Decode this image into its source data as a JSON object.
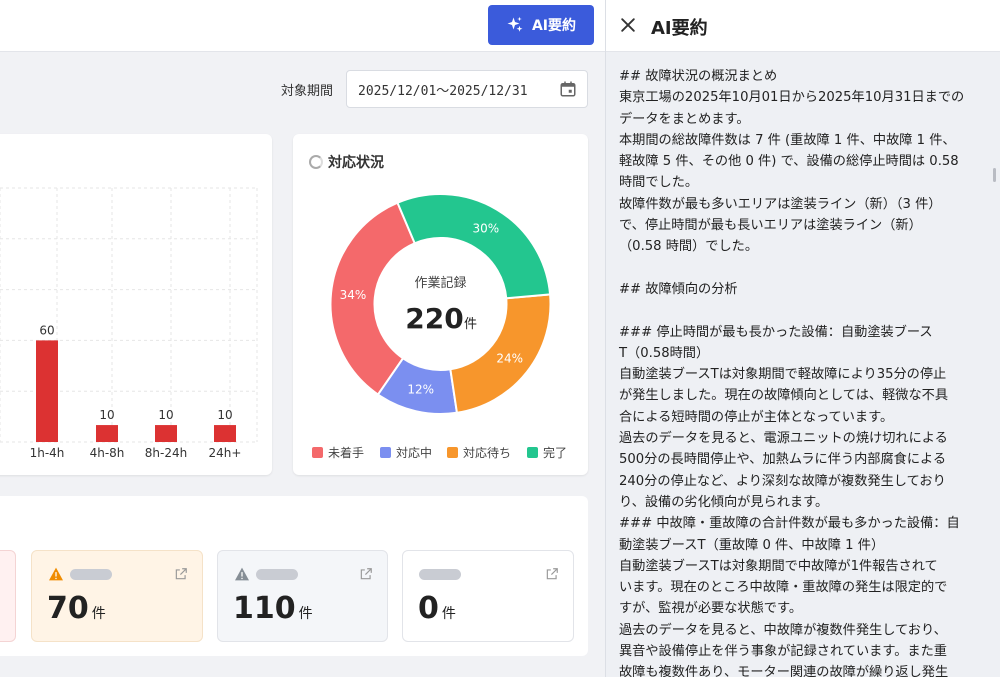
{
  "toolbar": {
    "ai_button_label": "AI要約"
  },
  "filter": {
    "period_label": "対象期間",
    "period_value": "2025/12/01〜2025/12/31"
  },
  "chart_data": [
    {
      "type": "bar",
      "categories": [
        "h",
        "1h-4h",
        "4h-8h",
        "8h-24h",
        "24h+"
      ],
      "values": [
        null,
        60,
        10,
        10,
        10
      ],
      "value_labels": [
        "",
        "60",
        "10",
        "10",
        "10"
      ],
      "ylim": [
        0,
        150
      ],
      "grid": true,
      "colors": {
        "bar": "#dc3232",
        "grid": "#e6e6e6"
      }
    },
    {
      "type": "pie",
      "title": "対応状況",
      "center_label": "作業記録",
      "center_value": "220",
      "center_unit": "件",
      "series": [
        {
          "name": "未着手",
          "value": 34,
          "label": "34%",
          "color": "#f4696b"
        },
        {
          "name": "対応中",
          "value": 12,
          "label": "12%",
          "color": "#7b8ff0"
        },
        {
          "name": "対応待ち",
          "value": 24,
          "label": "24%",
          "color": "#f7962c"
        },
        {
          "name": "完了",
          "value": 30,
          "label": "30%",
          "color": "#23c68f"
        }
      ]
    }
  ],
  "stats": [
    {
      "value": "70",
      "unit": "件",
      "icon": "warning-icon",
      "bg": "#fff4e6",
      "icon_color": "#f08c00"
    },
    {
      "value": "110",
      "unit": "件",
      "icon": "warning-icon",
      "bg": "#f4f6f9",
      "icon_color": "#868e96"
    },
    {
      "value": "0",
      "unit": "件",
      "icon": "none",
      "bg": "#ffffff"
    }
  ],
  "ai_panel": {
    "title": "AI要約",
    "lines": [
      "## 故障状況の概況まとめ",
      "東京工場の2025年10月01日から2025年10月31日までの",
      "データをまとめます。",
      "本期間の総故障件数は 7 件 (重故障 1 件、中故障 1 件、",
      "軽故障 5 件、その他 0 件) で、設備の総停止時間は 0.58",
      "時間でした。",
      "故障件数が最も多いエリアは塗装ライン（新）（3 件）",
      "で、停止時間が最も長いエリアは塗装ライン（新）",
      "（0.58 時間）でした。",
      "",
      "## 故障傾向の分析",
      "",
      "### 停止時間が最も長かった設備：自動塗装ブース",
      "T（0.58時間）",
      "自動塗装ブースTは対象期間で軽故障により35分の停止",
      "が発生しました。現在の故障傾向としては、軽微な不具",
      "合による短時間の停止が主体となっています。",
      "過去のデータを見ると、電源ユニットの焼け切れによる",
      "500分の長時間停止や、加熱ムラに伴う内部腐食による",
      "240分の停止など、より深刻な故障が複数発生しており",
      "り、設備の劣化傾向が見られます。",
      "### 中故障・重故障の合計件数が最も多かった設備：自",
      "動塗装ブースT（重故障 0 件、中故障 1 件）",
      "自動塗装ブースTは対象期間で中故障が1件報告されて",
      "います。現在のところ中故障・重故障の発生は限定的で",
      "すが、監視が必要な状態です。",
      "過去のデータを見ると、中故障が複数件発生しており、",
      "異音や設備停止を伴う事象が記録されています。また重",
      "故障も複数件あり、モーター関連の故障が繰り返し発生"
    ]
  }
}
